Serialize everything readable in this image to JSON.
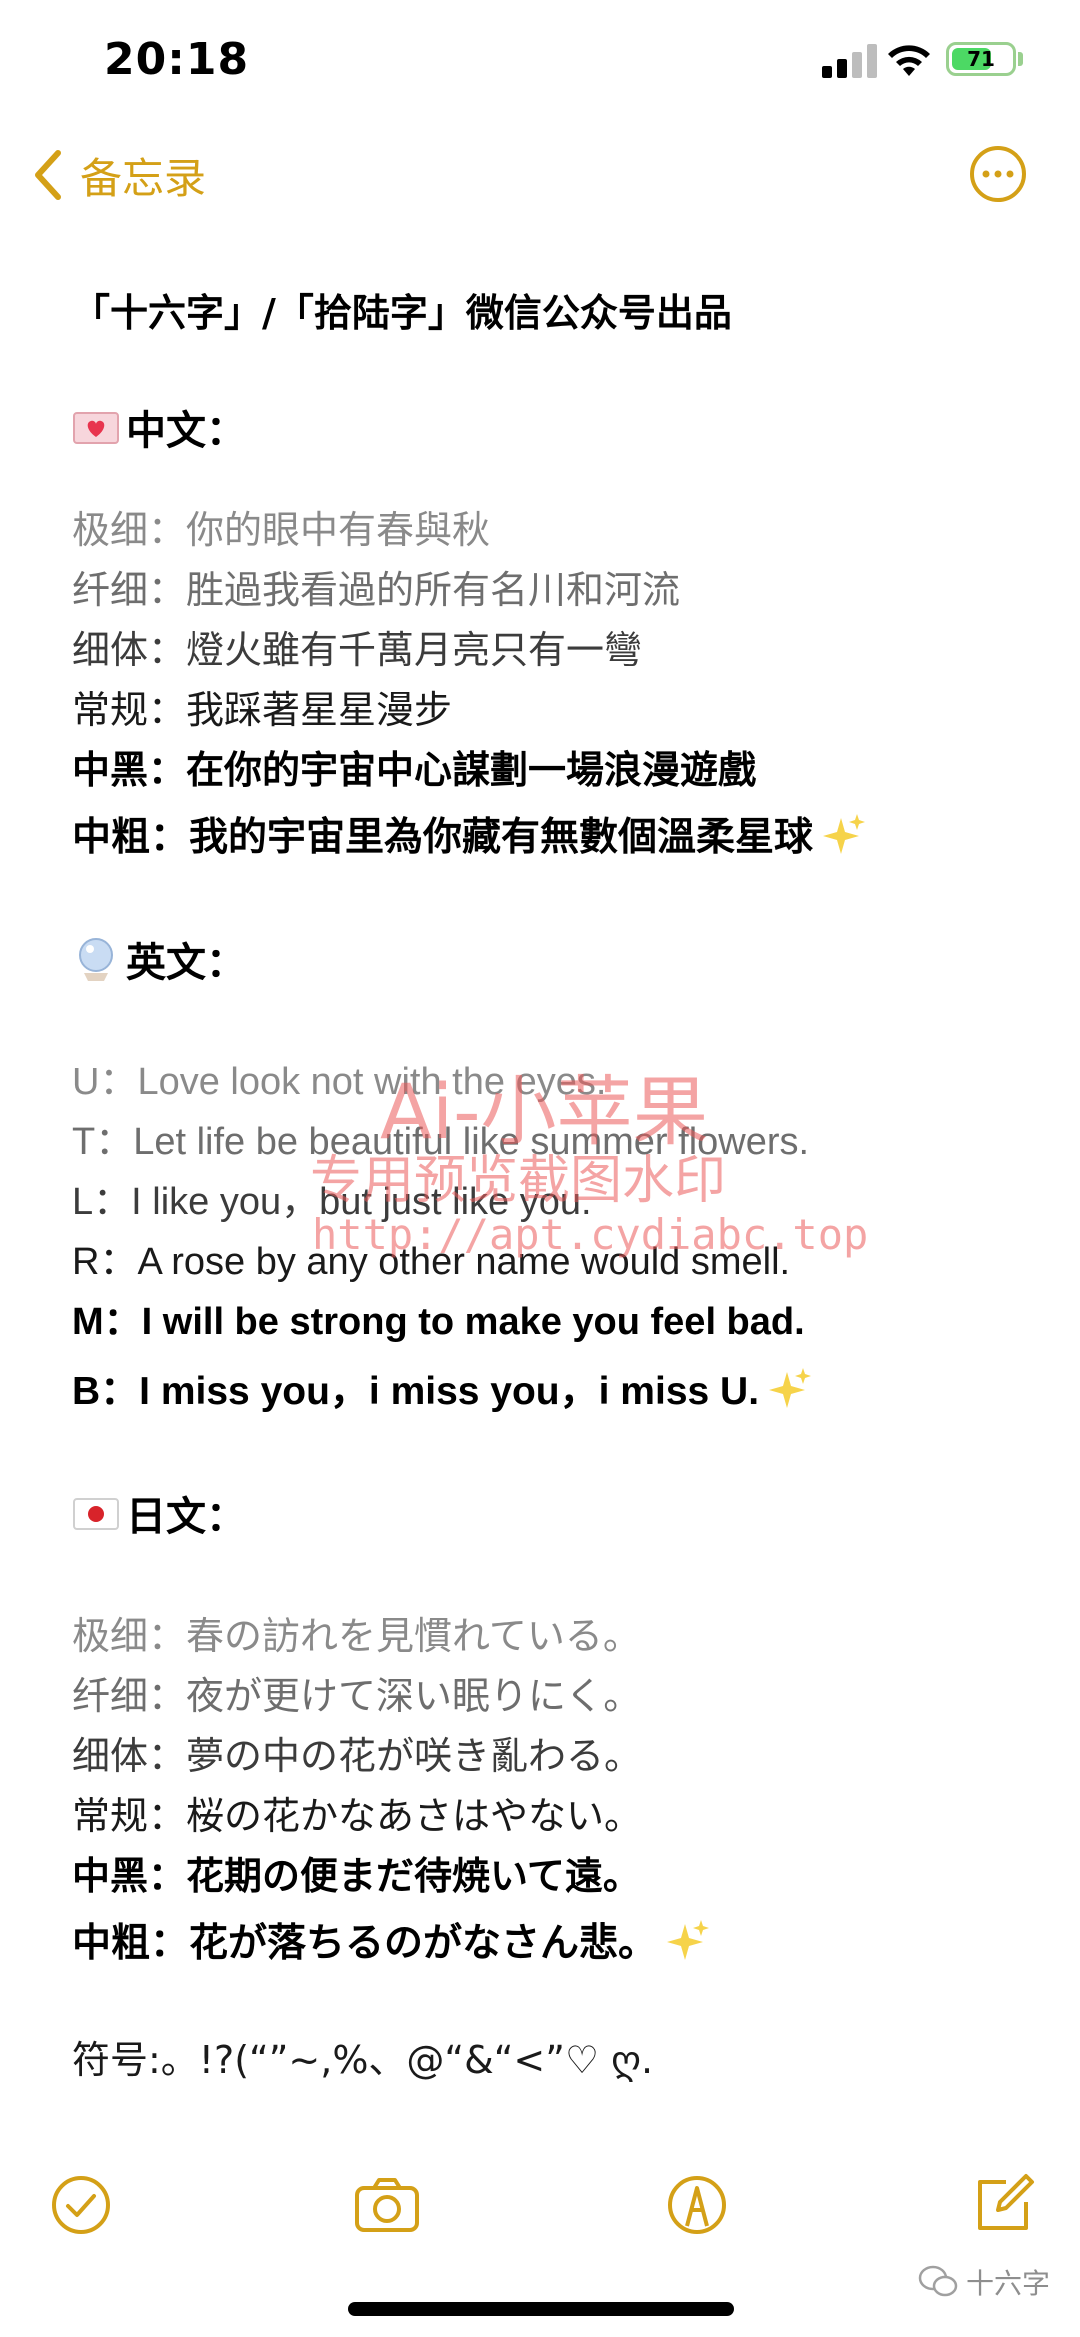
{
  "status_bar": {
    "time": "20:18",
    "battery": "71",
    "battery_level": 0.71
  },
  "nav": {
    "back_label": "备忘录"
  },
  "note": {
    "title": "「十六字」/「拾陆字」微信公众号出品",
    "sections": [
      {
        "heading": "中文：",
        "emoji": "heart-letter-emoji",
        "lines": [
          "极细：你的眼中有春與秋",
          "纤细：胜過我看過的所有名川和河流",
          "细体：燈火雖有千萬月亮只有一彎",
          "常规：我踩著星星漫步",
          "中黑：在你的宇宙中心謀劃一場浪漫遊戲",
          "中粗：我的宇宙里為你藏有無數個溫柔星球"
        ]
      },
      {
        "heading": "英文：",
        "emoji": "crystal-ball-emoji",
        "lines": [
          "U：Love look not with the eyes.",
          "T：Let life be beautiful like summer flowers.",
          "L：I like you，but just like you.",
          "R：A rose by any other name would smell.",
          "M：I will be strong to make you feel bad.",
          "B：I miss you，i miss you，i miss U."
        ]
      },
      {
        "heading": "日文：",
        "emoji": "japan-flag-emoji",
        "lines": [
          "极细：春の訪れを見慣れている。",
          "纤细：夜が更けて深い眠りにく。",
          "细体：夢の中の花が咲き亂わる。",
          "常规：桜の花かなあさはやない。",
          "中黑：花期の便まだ待焼いて遠。",
          "中粗：花が落ちるのがなさん悲。"
        ]
      }
    ],
    "symbols": "符号:。!?(“”~,%、@“&“<”♡ ღ."
  },
  "watermark": {
    "line1": "Ai-小苹果",
    "line2": "专用预览截图水印",
    "line3": "http://apt.cydiabc.top"
  },
  "footer_mark": "十六字",
  "colors": {
    "accent": "#d4a017",
    "battery_green": "#4cd964",
    "watermark_red": "#eb5a5a"
  }
}
